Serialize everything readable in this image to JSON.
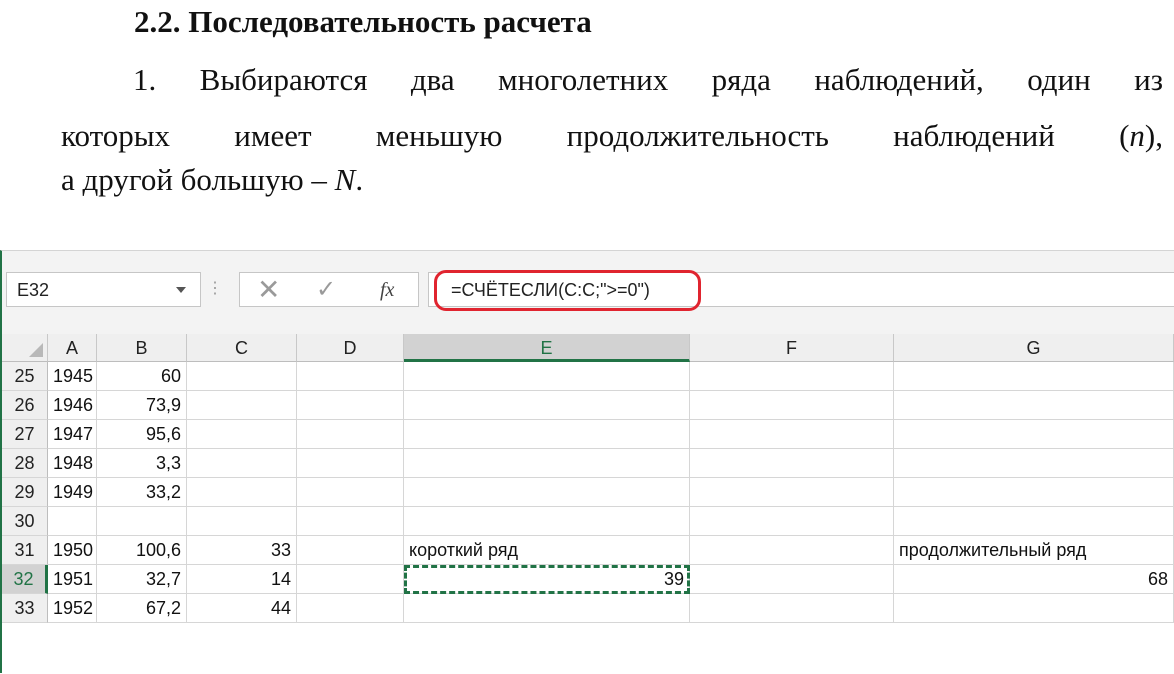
{
  "document": {
    "heading": "2.2. Последовательность расчета",
    "para_line1": "1. Выбираются два многолетних ряда наблюдений, один из",
    "para_line2_start": "которых имеет меньшую продолжительность наблюдений (",
    "para_line2_var": "n",
    "para_line2_end": "),",
    "para_line3_start": "а другой большую – ",
    "para_line3_var": "N",
    "para_line3_end": "."
  },
  "excel": {
    "name_box": "E32",
    "separator": "⋮",
    "cancel_glyph": "✕",
    "enter_glyph": "✓",
    "fx_label": "fx",
    "formula": "=СЧЁТЕСЛИ(C:C;\">=0\")",
    "highlight_color": "#e0242f",
    "accent_color": "#217346",
    "columns": [
      "A",
      "B",
      "C",
      "D",
      "E",
      "F",
      "G"
    ],
    "selected_column": "E",
    "selected_row": "32",
    "rows": [
      {
        "num": "25",
        "cells": [
          "1945",
          "60",
          "",
          "",
          "",
          "",
          ""
        ]
      },
      {
        "num": "26",
        "cells": [
          "1946",
          "73,9",
          "",
          "",
          "",
          "",
          ""
        ]
      },
      {
        "num": "27",
        "cells": [
          "1947",
          "95,6",
          "",
          "",
          "",
          "",
          ""
        ]
      },
      {
        "num": "28",
        "cells": [
          "1948",
          "3,3",
          "",
          "",
          "",
          "",
          ""
        ]
      },
      {
        "num": "29",
        "cells": [
          "1949",
          "33,2",
          "",
          "",
          "",
          "",
          ""
        ]
      },
      {
        "num": "30",
        "cells": [
          "",
          "",
          "",
          "",
          "",
          "",
          ""
        ]
      },
      {
        "num": "31",
        "cells": [
          "1950",
          "100,6",
          "33",
          "",
          "короткий ряд",
          "",
          "продолжительный ряд"
        ]
      },
      {
        "num": "32",
        "cells": [
          "1951",
          "32,7",
          "14",
          "",
          "39",
          "",
          "68"
        ]
      },
      {
        "num": "33",
        "cells": [
          "1952",
          "67,2",
          "44",
          "",
          "",
          "",
          ""
        ]
      }
    ]
  }
}
